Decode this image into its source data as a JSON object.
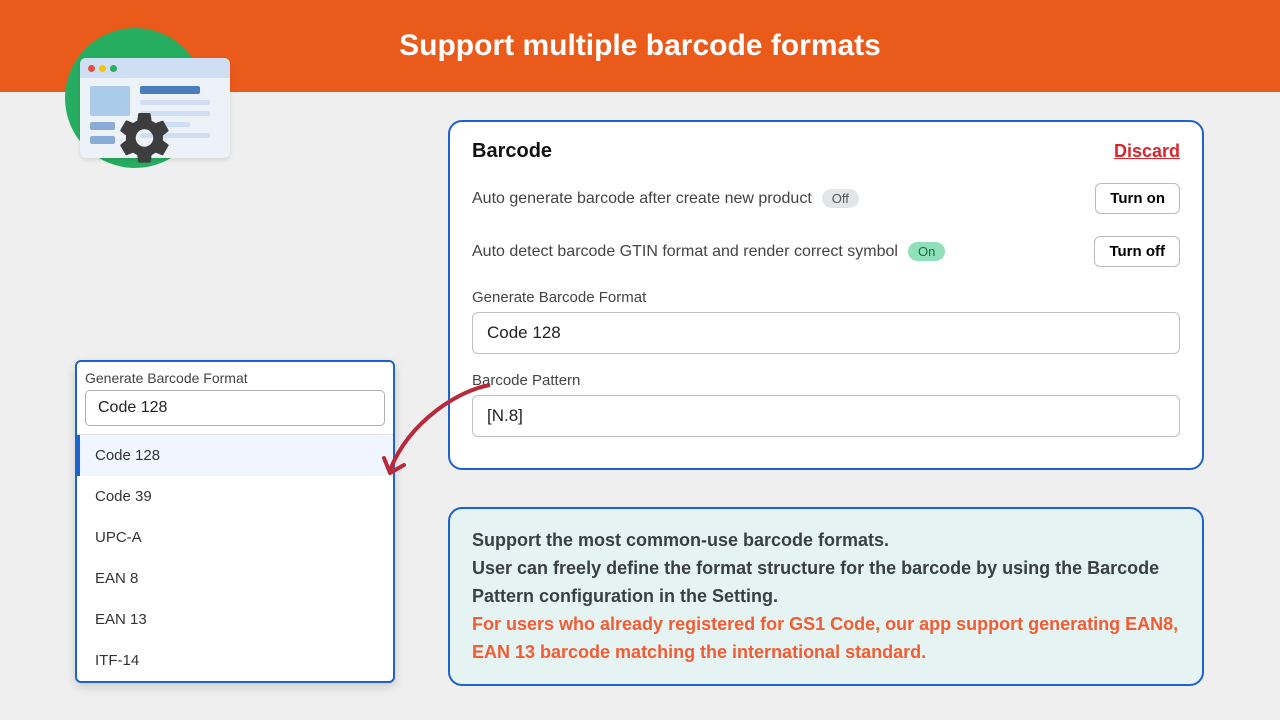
{
  "header": {
    "title": "Support multiple barcode formats"
  },
  "barcode_panel": {
    "title": "Barcode",
    "discard": "Discard",
    "auto_generate_label": "Auto generate barcode after create new product",
    "auto_generate_status": "Off",
    "auto_generate_button": "Turn on",
    "auto_detect_label": "Auto detect barcode GTIN format and render correct symbol",
    "auto_detect_status": "On",
    "auto_detect_button": "Turn off",
    "format_label": "Generate Barcode Format",
    "format_value": "Code 128",
    "pattern_label": "Barcode Pattern",
    "pattern_value": "[N.8]"
  },
  "dropdown": {
    "label": "Generate Barcode Format",
    "value": "Code 128",
    "options": [
      "Code 128",
      "Code 39",
      "UPC-A",
      "EAN 8",
      "EAN 13",
      "ITF-14"
    ]
  },
  "info": {
    "line1": "Support the most common-use barcode formats.",
    "line2": "User can freely define the format structure for the barcode by using the Barcode Pattern configuration in the Setting.",
    "line3": "For users who already registered for GS1 Code, our app support generating EAN8, EAN 13 barcode matching the international standard."
  }
}
